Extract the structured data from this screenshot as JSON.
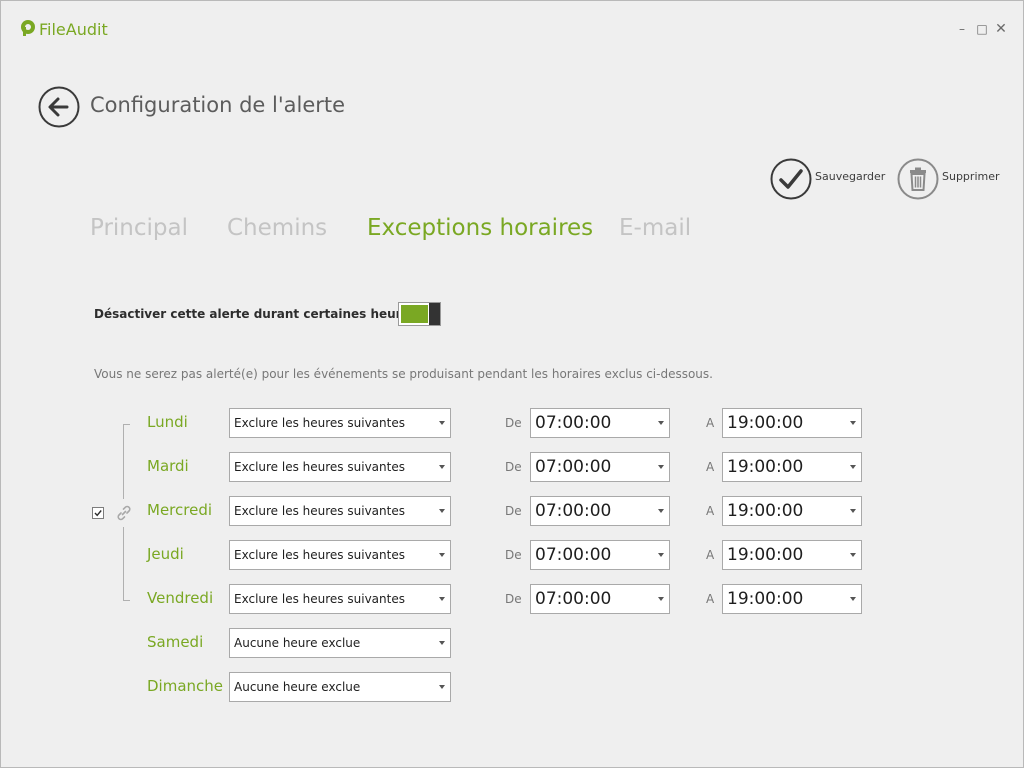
{
  "window": {
    "app_name": "FileAudit",
    "controls": {
      "minimize": "–",
      "maximize": "□",
      "close": "✕"
    }
  },
  "header": {
    "back_icon": "arrow-left-circle-icon",
    "title": "Configuration de l'alerte"
  },
  "actions": [
    {
      "label": "Sauvegarder",
      "icon": "checkmark-circle-icon"
    },
    {
      "label": "Supprimer",
      "icon": "trash-circle-icon"
    }
  ],
  "tabs": [
    {
      "label": "Principal",
      "active": false
    },
    {
      "label": "Chemins",
      "active": false
    },
    {
      "label": "Exceptions horaires",
      "active": true
    },
    {
      "label": "E-mail",
      "active": false
    }
  ],
  "toggle": {
    "label": "Désactiver cette alerte durant certaines heures",
    "enabled": true
  },
  "info_text": "Vous ne serez pas alerté(e) pour les événements se produisant pendant les horaires exclus ci-dessous.",
  "link_weekdays_checked": true,
  "time_labels": {
    "from": "De",
    "to": "A"
  },
  "days": [
    {
      "name": "Lundi",
      "mode": "Exclure les heures suivantes",
      "from": "07:00:00",
      "to": "19:00:00"
    },
    {
      "name": "Mardi",
      "mode": "Exclure les heures suivantes",
      "from": "07:00:00",
      "to": "19:00:00"
    },
    {
      "name": "Mercredi",
      "mode": "Exclure les heures suivantes",
      "from": "07:00:00",
      "to": "19:00:00"
    },
    {
      "name": "Jeudi",
      "mode": "Exclure les heures suivantes",
      "from": "07:00:00",
      "to": "19:00:00"
    },
    {
      "name": "Vendredi",
      "mode": "Exclure les heures suivantes",
      "from": "07:00:00",
      "to": "19:00:00"
    },
    {
      "name": "Samedi",
      "mode": "Aucune heure exclue"
    },
    {
      "name": "Dimanche",
      "mode": "Aucune heure exclue"
    }
  ],
  "colors": {
    "accent": "#7aa823",
    "inactive_tab": "#c4c4c4",
    "background": "#efefef"
  }
}
